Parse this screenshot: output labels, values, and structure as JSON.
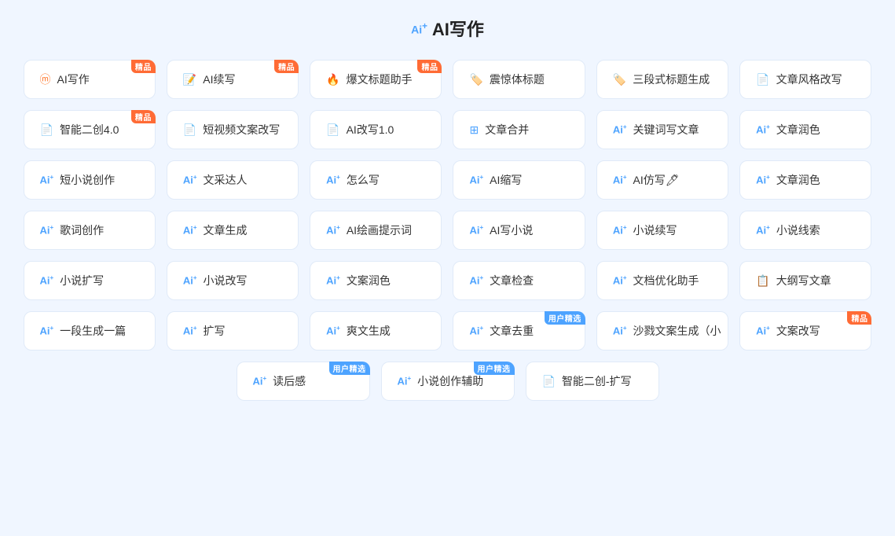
{
  "page": {
    "title": "AI写作",
    "title_icon": "Ai⁺"
  },
  "rows": [
    {
      "id": "row1",
      "cards": [
        {
          "id": "ai-write",
          "icon_type": "special-write",
          "label": "AI写作",
          "badge": "精品",
          "badge_type": "orange"
        },
        {
          "id": "ai-continue",
          "icon_type": "special-continue",
          "label": "AI续写",
          "badge": "精品",
          "badge_type": "orange"
        },
        {
          "id": "title-helper",
          "icon_type": "special-fire",
          "label": "爆文标题助手",
          "badge": "精品",
          "badge_type": "orange"
        },
        {
          "id": "shock-title",
          "icon_type": "special-tag",
          "label": "震惊体标题",
          "badge": null
        },
        {
          "id": "three-title",
          "icon_type": "special-tag2",
          "label": "三段式标题生成",
          "badge": null
        },
        {
          "id": "style-rewrite",
          "icon_type": "doc",
          "label": "文章风格改写",
          "badge": null
        }
      ]
    },
    {
      "id": "row2",
      "cards": [
        {
          "id": "smart-create",
          "icon_type": "doc",
          "label": "智能二创4.0",
          "badge": "精品",
          "badge_type": "orange"
        },
        {
          "id": "short-video",
          "icon_type": "doc",
          "label": "短视频文案改写",
          "badge": null
        },
        {
          "id": "ai-rewrite",
          "icon_type": "doc",
          "label": "AI改写1.0",
          "badge": null
        },
        {
          "id": "article-merge",
          "icon_type": "merge",
          "label": "文章合并",
          "badge": null
        },
        {
          "id": "keyword-write",
          "icon_type": "ai",
          "label": "关键词写文章",
          "badge": null
        },
        {
          "id": "article-polish1",
          "icon_type": "ai",
          "label": "文章润色",
          "badge": null
        }
      ]
    },
    {
      "id": "row3",
      "cards": [
        {
          "id": "short-novel",
          "icon_type": "ai",
          "label": "短小说创作",
          "badge": null
        },
        {
          "id": "writing-style",
          "icon_type": "ai",
          "label": "文采达人",
          "badge": null
        },
        {
          "id": "how-write",
          "icon_type": "ai",
          "label": "怎么写",
          "badge": null
        },
        {
          "id": "ai-shorten",
          "icon_type": "ai",
          "label": "AI缩写",
          "badge": null
        },
        {
          "id": "ai-imitate",
          "icon_type": "ai",
          "label": "AI仿写🖊",
          "badge": null
        },
        {
          "id": "article-polish2",
          "icon_type": "ai",
          "label": "文章润色",
          "badge": null
        }
      ]
    },
    {
      "id": "row4",
      "cards": [
        {
          "id": "lyric-create",
          "icon_type": "ai",
          "label": "歌词创作",
          "badge": null
        },
        {
          "id": "article-gen",
          "icon_type": "ai",
          "label": "文章生成",
          "badge": null
        },
        {
          "id": "ai-paint-prompt",
          "icon_type": "ai",
          "label": "AI绘画提示词",
          "badge": null
        },
        {
          "id": "ai-write-novel",
          "icon_type": "ai",
          "label": "AI写小说",
          "badge": null
        },
        {
          "id": "novel-continue",
          "icon_type": "ai",
          "label": "小说续写",
          "badge": null
        },
        {
          "id": "novel-clue",
          "icon_type": "ai",
          "label": "小说线索",
          "badge": null
        }
      ]
    },
    {
      "id": "row5",
      "cards": [
        {
          "id": "novel-expand",
          "icon_type": "ai",
          "label": "小说扩写",
          "badge": null
        },
        {
          "id": "novel-rewrite",
          "icon_type": "ai",
          "label": "小说改写",
          "badge": null
        },
        {
          "id": "copy-polish",
          "icon_type": "ai",
          "label": "文案润色",
          "badge": null
        },
        {
          "id": "article-check",
          "icon_type": "ai",
          "label": "文章检查",
          "badge": null
        },
        {
          "id": "doc-optimize",
          "icon_type": "ai",
          "label": "文档优化助手",
          "badge": null
        },
        {
          "id": "outline-write",
          "icon_type": "outline",
          "label": "大纲写文章",
          "badge": null
        }
      ]
    },
    {
      "id": "row6",
      "cards": [
        {
          "id": "one-para",
          "icon_type": "ai",
          "label": "一段生成一篇",
          "badge": null
        },
        {
          "id": "expand-write",
          "icon_type": "ai",
          "label": "扩写",
          "badge": null
        },
        {
          "id": "fresh-gen",
          "icon_type": "ai",
          "label": "爽文生成",
          "badge": null
        },
        {
          "id": "dedup-article",
          "icon_type": "ai",
          "label": "文章去重",
          "badge": "用户精选",
          "badge_type": "blue"
        },
        {
          "id": "sand-copy",
          "icon_type": "ai",
          "label": "沙戮文案生成（小",
          "badge": null
        },
        {
          "id": "copy-improve",
          "icon_type": "ai",
          "label": "文案改写",
          "badge": "精品",
          "badge_type": "orange"
        }
      ]
    },
    {
      "id": "row7",
      "center": true,
      "cards": [
        {
          "id": "read-review",
          "icon_type": "ai",
          "label": "读后感",
          "badge": "用户精选",
          "badge_type": "blue"
        },
        {
          "id": "novel-assist",
          "icon_type": "ai",
          "label": "小说创作辅助",
          "badge": "用户精选",
          "badge_type": "blue"
        },
        {
          "id": "smart-expand",
          "icon_type": "doc",
          "label": "智能二创-扩写",
          "badge": null
        }
      ]
    }
  ]
}
